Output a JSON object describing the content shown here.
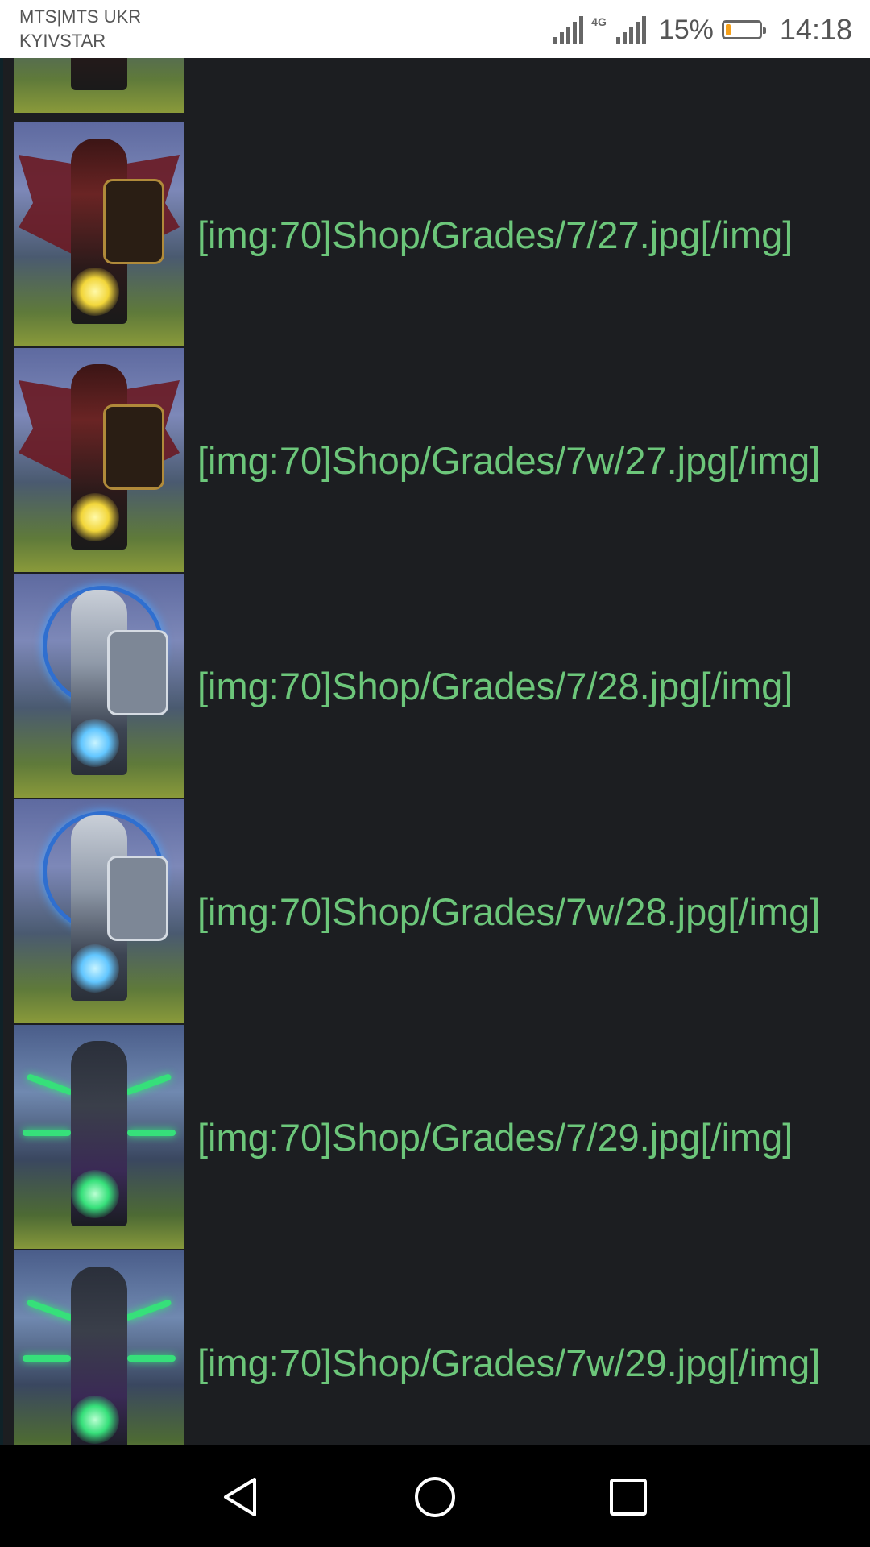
{
  "status_bar": {
    "carrier_line1": "MTS|MTS UKR",
    "carrier_line2": "KYIVSTAR",
    "network_type": "4G",
    "battery_percent": "15%",
    "battery_level": 0.15,
    "time": "14:18"
  },
  "list": {
    "items": [
      {
        "label": "[img:70]Shop/Grades/7/27.jpg[/img]",
        "image_name": "red-winged-warrior-male"
      },
      {
        "label": "[img:70]Shop/Grades/7w/27.jpg[/img]",
        "image_name": "red-winged-warrior-female"
      },
      {
        "label": "[img:70]Shop/Grades/7/28.jpg[/img]",
        "image_name": "silver-knight-male"
      },
      {
        "label": "[img:70]Shop/Grades/7w/28.jpg[/img]",
        "image_name": "silver-knight-female"
      },
      {
        "label": "[img:70]Shop/Grades/7/29.jpg[/img]",
        "image_name": "green-spiked-warrior-male"
      },
      {
        "label": "[img:70]Shop/Grades/7w/29.jpg[/img]",
        "image_name": "green-spiked-warrior-female"
      }
    ]
  },
  "colors": {
    "label_text": "#6cc67a",
    "background": "#1c1e21",
    "battery_low": "#f5a01a"
  },
  "nav_bar": {
    "back_icon": "back-triangle-icon",
    "home_icon": "home-circle-icon",
    "recent_icon": "recent-square-icon"
  }
}
